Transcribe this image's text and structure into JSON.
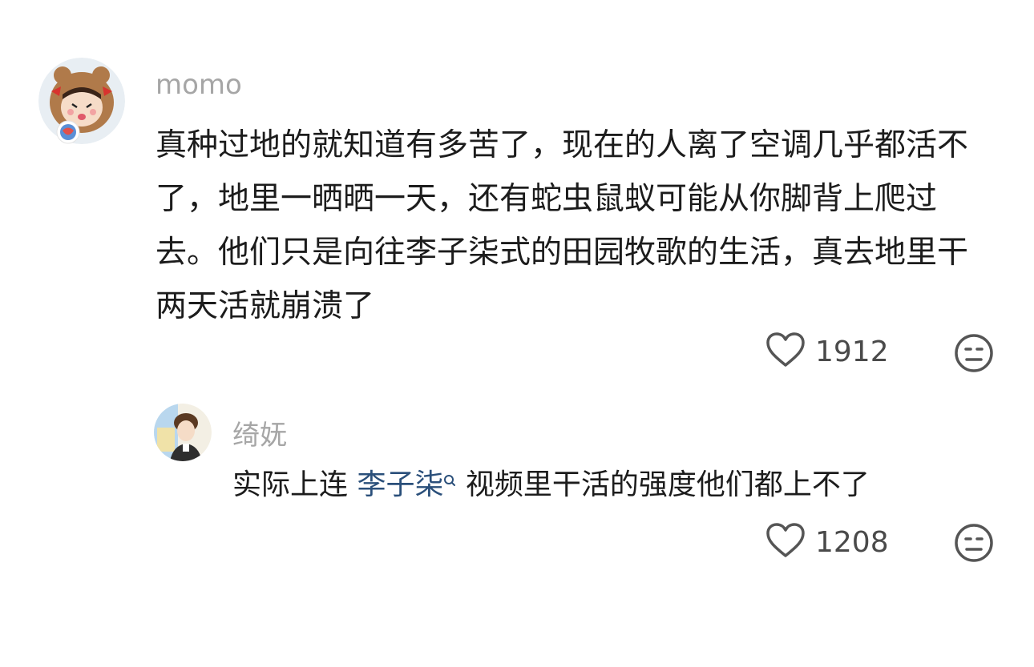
{
  "comments": [
    {
      "username": "momo",
      "text": "真种过地的就知道有多苦了，现在的人离了空调几乎都活不了，地里一晒晒一天，还有蛇虫鼠蚁可能从你脚背上爬过去。他们只是向往李子柒式的田园牧歌的生活，真去地里干两天活就崩溃了",
      "like_count": "1912",
      "icons": {
        "like": "heart-outline-icon",
        "dislike": "unamused-face-icon"
      }
    },
    {
      "username": "绮妩",
      "text_before": "实际上连 ",
      "mention": "李子柒",
      "text_after": " 视频里干活的强度他们都上不了",
      "like_count": "1208",
      "icons": {
        "like": "heart-outline-icon",
        "dislike": "unamused-face-icon",
        "mention": "search-icon"
      }
    }
  ]
}
